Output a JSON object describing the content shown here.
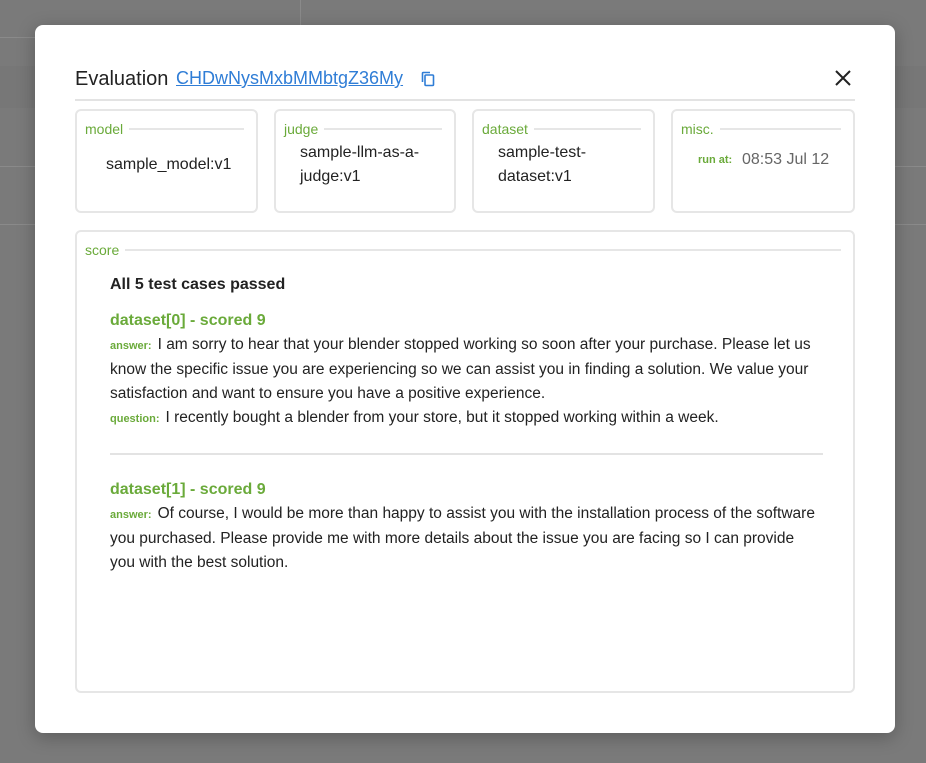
{
  "modal": {
    "title": "Evaluation",
    "evaluation_id": "CHDwNysMxbMMbtgZ36My",
    "copy_icon": "copy-icon",
    "close_icon": "close-icon"
  },
  "fields": {
    "model": {
      "legend": "model",
      "value": "sample_model:v1"
    },
    "judge": {
      "legend": "judge",
      "value_line1": "sample-llm-as-a-",
      "value_line2": "judge:v1"
    },
    "dataset": {
      "legend": "dataset",
      "value_line1": "sample-test-",
      "value_line2": "dataset:v1"
    },
    "misc": {
      "legend": "misc.",
      "run_at_label": "run at:",
      "run_at_value": "08:53 Jul 12"
    }
  },
  "score": {
    "legend": "score",
    "summary": "All 5 test cases passed",
    "cases": [
      {
        "title": "dataset[0] - scored 9",
        "answer_label": "answer:",
        "answer": "I am sorry to hear that your blender stopped working so soon after your purchase. Please let us know the specific issue you are experiencing so we can assist you in finding a solution. We value your satisfaction and want to ensure you have a positive experience.",
        "question_label": "question:",
        "question": "I recently bought a blender from your store, but it stopped working within a week."
      },
      {
        "title": "dataset[1] - scored 9",
        "answer_label": "answer:",
        "answer": "Of course, I would be more than happy to assist you with the installation process of the software you purchased. Please provide me with more details about the issue you are facing so I can provide you with the best solution."
      }
    ]
  },
  "colors": {
    "accent_green": "#6aaa3a",
    "link_blue": "#2f7dd6",
    "backdrop": "#7a7a7a"
  }
}
